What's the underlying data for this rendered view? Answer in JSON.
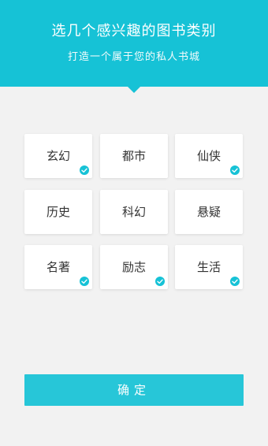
{
  "header": {
    "title": "选几个感兴趣的图书类别",
    "subtitle": "打造一个属于您的私人书城"
  },
  "categories": [
    {
      "label": "玄幻",
      "selected": true
    },
    {
      "label": "都市",
      "selected": false
    },
    {
      "label": "仙侠",
      "selected": true
    },
    {
      "label": "历史",
      "selected": false
    },
    {
      "label": "科幻",
      "selected": false
    },
    {
      "label": "悬疑",
      "selected": false
    },
    {
      "label": "名著",
      "selected": true
    },
    {
      "label": "励志",
      "selected": true
    },
    {
      "label": "生活",
      "selected": true
    }
  ],
  "confirm_label": "确定",
  "colors": {
    "accent": "#16c2d6",
    "button": "#27c6d8",
    "background": "#f2f2f2",
    "card": "#ffffff",
    "text": "#333333"
  }
}
